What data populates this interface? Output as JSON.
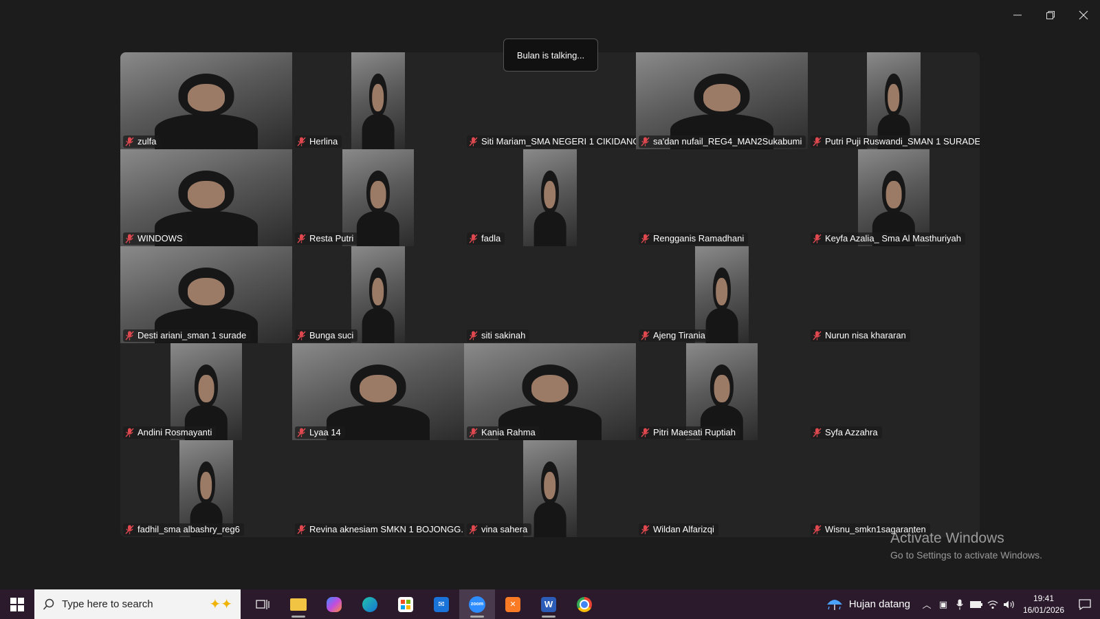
{
  "toast": "Bulan is talking...",
  "participants": [
    {
      "name": "zulfa",
      "video": "full"
    },
    {
      "name": "Herlina",
      "video": "mid"
    },
    {
      "name": "Siti Mariam_SMA NEGERI 1 CIKIDANG",
      "video": "none"
    },
    {
      "name": "sa'dan nufail_REG4_MAN2Sukabumi",
      "video": "full"
    },
    {
      "name": "Putri Puji Ruswandi_SMAN 1 SURADE",
      "video": "mid"
    },
    {
      "name": "WINDOWS",
      "video": "full"
    },
    {
      "name": "Resta Putri",
      "video": "mid"
    },
    {
      "name": "fadla",
      "video": "mid"
    },
    {
      "name": "Rengganis Ramadhani",
      "video": "none"
    },
    {
      "name": "Keyfa Azalia_ Sma Al Masthuriyah",
      "video": "mid"
    },
    {
      "name": "Desti ariani_sman 1 surade",
      "video": "full"
    },
    {
      "name": "Bunga suci",
      "video": "mid"
    },
    {
      "name": "siti sakinah",
      "video": "none"
    },
    {
      "name": "Ajeng Tirania",
      "video": "mid"
    },
    {
      "name": "Nurun nisa khararan",
      "video": "none"
    },
    {
      "name": "Andini Rosmayanti",
      "video": "mid"
    },
    {
      "name": "Lyaa 14",
      "video": "full"
    },
    {
      "name": "Kania Rahma",
      "video": "full"
    },
    {
      "name": "Pitri Maesati Ruptiah",
      "video": "mid"
    },
    {
      "name": "Syfa Azzahra",
      "video": "none"
    },
    {
      "name": "fadhil_sma albashry_reg6",
      "video": "mid"
    },
    {
      "name": "Revina aknesiam SMKN 1 BOJONGG...",
      "video": "none"
    },
    {
      "name": "vina sahera",
      "video": "mid"
    },
    {
      "name": "Wildan Alfarizqi",
      "video": "none"
    },
    {
      "name": "Wisnu_smkn1sagaranten",
      "video": "none"
    }
  ],
  "watermark": {
    "title": "Activate Windows",
    "subtitle": "Go to Settings to activate Windows."
  },
  "taskbar": {
    "search_placeholder": "Type here to search",
    "apps": [
      {
        "name": "task-view",
        "label": ""
      },
      {
        "name": "file-explorer",
        "label": ""
      },
      {
        "name": "copilot",
        "label": ""
      },
      {
        "name": "edge",
        "label": ""
      },
      {
        "name": "microsoft-store",
        "label": ""
      },
      {
        "name": "outlook",
        "label": ""
      },
      {
        "name": "zoom",
        "label": "zoom"
      },
      {
        "name": "xampp",
        "label": ""
      },
      {
        "name": "word",
        "label": "W"
      },
      {
        "name": "chrome",
        "label": ""
      }
    ],
    "weather": "Hujan datang",
    "time": "19:41",
    "date": "16/01/2026"
  }
}
